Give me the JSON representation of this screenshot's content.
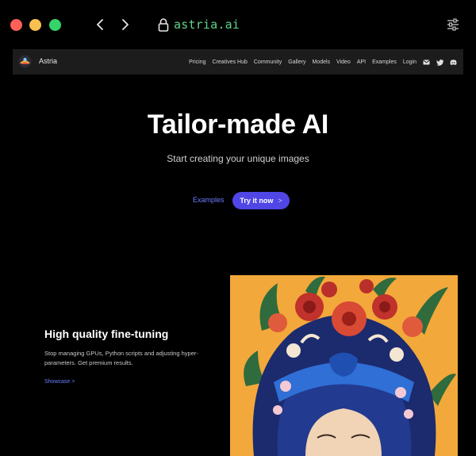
{
  "browser": {
    "url": "astria.ai",
    "icons": [
      "back-arrow-icon",
      "forward-arrow-icon",
      "lock-icon",
      "settings-sliders-icon"
    ]
  },
  "navbar": {
    "brand": "Astria",
    "links": [
      "Pricing",
      "Creatives Hub",
      "Community",
      "Gallery",
      "Models",
      "Video",
      "API",
      "Examples",
      "Login"
    ],
    "icons": [
      "mail-icon",
      "twitter-icon",
      "discord-icon"
    ]
  },
  "hero": {
    "title": "Tailor-made AI",
    "subtitle": "Start creating your unique images",
    "examples_label": "Examples",
    "try_label": "Try it now",
    "try_chevron": ">"
  },
  "feature": {
    "title": "High quality fine-tuning",
    "description": "Stop managing GPUs, Python scripts and adjusting hyper-parameters. Get premium results.",
    "link_label": "Showcase",
    "link_chevron": ">"
  },
  "colors": {
    "accent": "#5046e6",
    "link": "#6b7cff",
    "url_text": "#5fd48a",
    "art_background": "#f2a83a"
  }
}
